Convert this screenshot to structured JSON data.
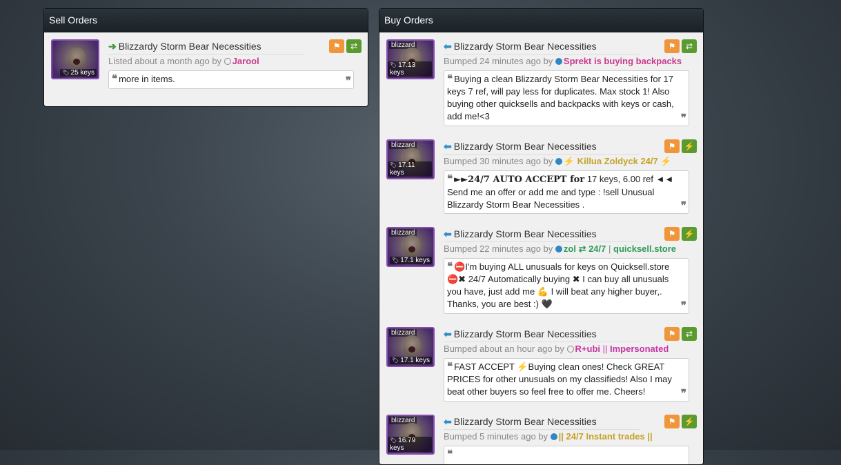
{
  "sell": {
    "header": "Sell Orders",
    "listings": [
      {
        "thumb_tag": "",
        "price": "25 keys",
        "title": "Blizzardy Storm Bear Necessities",
        "meta_prefix": "Listed about a month ago by",
        "user": "Jarool",
        "quote": "more in items."
      }
    ]
  },
  "buy": {
    "header": "Buy Orders",
    "listings": [
      {
        "thumb_tag": "blizzard",
        "price": "17.13 keys",
        "title": "Blizzardy Storm Bear Necessities",
        "meta_prefix": "Bumped 24 minutes ago by",
        "user": "Sprekt is buying backpacks",
        "quote": "Buying a clean Blizzardy Storm Bear Necessities for 17 keys 7 ref, will pay less for duplicates. Max stock 1! Also buying other quicksells and backpacks with keys or cash, add me!<3"
      },
      {
        "thumb_tag": "blizzard",
        "price": "17.11 keys",
        "title": "Blizzardy Storm Bear Necessities",
        "meta_prefix": "Bumped 30 minutes ago by",
        "user": "⚡ Killua Zoldyck 24/7 ⚡",
        "quote_bold": "►►24/7 AUTO ACCEPT for",
        "quote": " 17 keys, 6.00 ref ◄◄ Send me an offer or add me and type : !sell Unusual Blizzardy Storm Bear Necessities ."
      },
      {
        "thumb_tag": "blizzard",
        "price": "17.1 keys",
        "title": "Blizzardy Storm Bear Necessities",
        "meta_prefix": "Bumped 22 minutes ago by",
        "user": "zol ⇄ 24/7",
        "user_sep": " | ",
        "user_extra": "quicksell.store",
        "quote": "⛔I'm buying ALL unusuals for keys on Quicksell.store⛔✖ 24/7 Automatically buying ✖ I can buy all unusuals you have, just add me 💪 I will beat any higher buyer,. Thanks, you are best :) 🖤"
      },
      {
        "thumb_tag": "blizzard",
        "price": "17.1 keys",
        "title": "Blizzardy Storm Bear Necessities",
        "meta_prefix": "Bumped about an hour ago by",
        "user": "R+ubi",
        "user_sep": " || ",
        "user_extra": "Impersonated",
        "quote": "FAST ACCEPT ⚡Buying clean ones! Check GREAT PRICES for other unusuals on my classifieds! Also I may beat other buyers so feel free to offer me. Cheers!"
      },
      {
        "thumb_tag": "blizzard",
        "price": "16.79 keys",
        "title": "Blizzardy Storm Bear Necessities",
        "meta_prefix": "Bumped 5 minutes ago by",
        "user": "|| 24/7 Instant trades ||",
        "quote": ""
      }
    ]
  },
  "colors": {
    "sell_arrow": "#3c9b37",
    "buy_arrow": "#2e8fc7",
    "flag_button": "#f1953a",
    "action_button": "#5a9a2f",
    "quality_border": "#8650ac"
  }
}
